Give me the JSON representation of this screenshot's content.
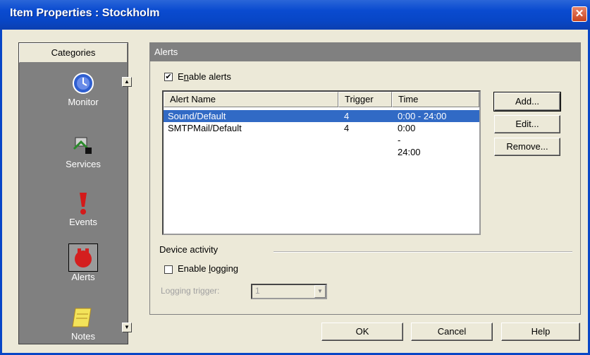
{
  "window": {
    "title": "Item Properties : Stockholm",
    "close_glyph": "✕"
  },
  "categories": {
    "header": "Categories",
    "items": [
      {
        "label": "Monitor",
        "icon": "monitor-icon"
      },
      {
        "label": "Services",
        "icon": "services-icon"
      },
      {
        "label": "Events",
        "icon": "events-icon"
      },
      {
        "label": "Alerts",
        "icon": "alerts-icon",
        "selected": true
      },
      {
        "label": "Notes",
        "icon": "notes-icon"
      }
    ],
    "scroll_up": "▲",
    "scroll_down": "▼"
  },
  "alerts": {
    "panel_title": "Alerts",
    "enable_alerts": {
      "prefix": "E",
      "underlined": "n",
      "suffix": "able alerts",
      "checked": true,
      "mark": "✔"
    },
    "columns": [
      "Alert Name",
      "Trigger",
      "Time"
    ],
    "rows": [
      {
        "name": "Sound/Default",
        "trigger": "4",
        "time": "0:00 - 24:00",
        "selected": true
      },
      {
        "name": "SMTPMail/Default",
        "trigger": "4",
        "time": "0:00 - 24:00",
        "selected": false
      }
    ],
    "buttons": {
      "add": "Add...",
      "edit": "Edit...",
      "remove": "Remove..."
    }
  },
  "device_activity": {
    "group_label": "Device activity",
    "enable_logging": {
      "prefix": "Enable ",
      "underlined": "l",
      "suffix": "ogging",
      "checked": false
    },
    "logging_trigger_label": "Logging trigger:",
    "logging_trigger_value": "1",
    "combo_arrow": "▼"
  },
  "footer": {
    "ok": "OK",
    "cancel": "Cancel",
    "help": "Help"
  },
  "colors": {
    "title_bar": "#0846c6",
    "selection": "#316ac5",
    "panel_gray": "#808080"
  }
}
